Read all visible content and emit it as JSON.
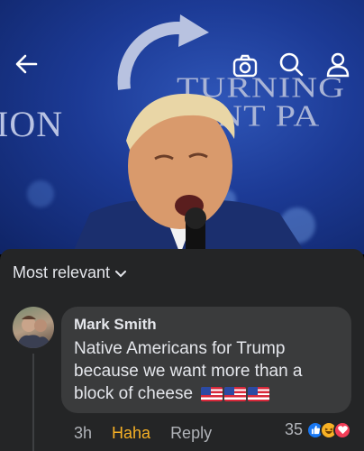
{
  "video": {
    "logo_line1": "TURNING",
    "logo_line2": "OINT PA",
    "logo_left": "ION"
  },
  "topbar": {
    "icons": [
      "back-arrow-icon",
      "camera-icon",
      "search-icon",
      "profile-icon"
    ]
  },
  "comments": {
    "sort_label": "Most relevant",
    "items": [
      {
        "author": "Mark Smith",
        "text": "Native Americans for Trump because we want more than a block of cheese",
        "time": "3h",
        "reaction_label": "Haha",
        "reply_label": "Reply",
        "reaction_count": "35",
        "reaction_icons": [
          "like-icon",
          "haha-icon",
          "love-icon"
        ]
      }
    ]
  },
  "colors": {
    "sheet_bg": "#242526",
    "bubble_bg": "#3a3b3c",
    "text": "#e4e6eb",
    "muted": "#b0b3b8",
    "haha": "#f7b125",
    "like": "#1877f2",
    "love": "#f33e58"
  }
}
